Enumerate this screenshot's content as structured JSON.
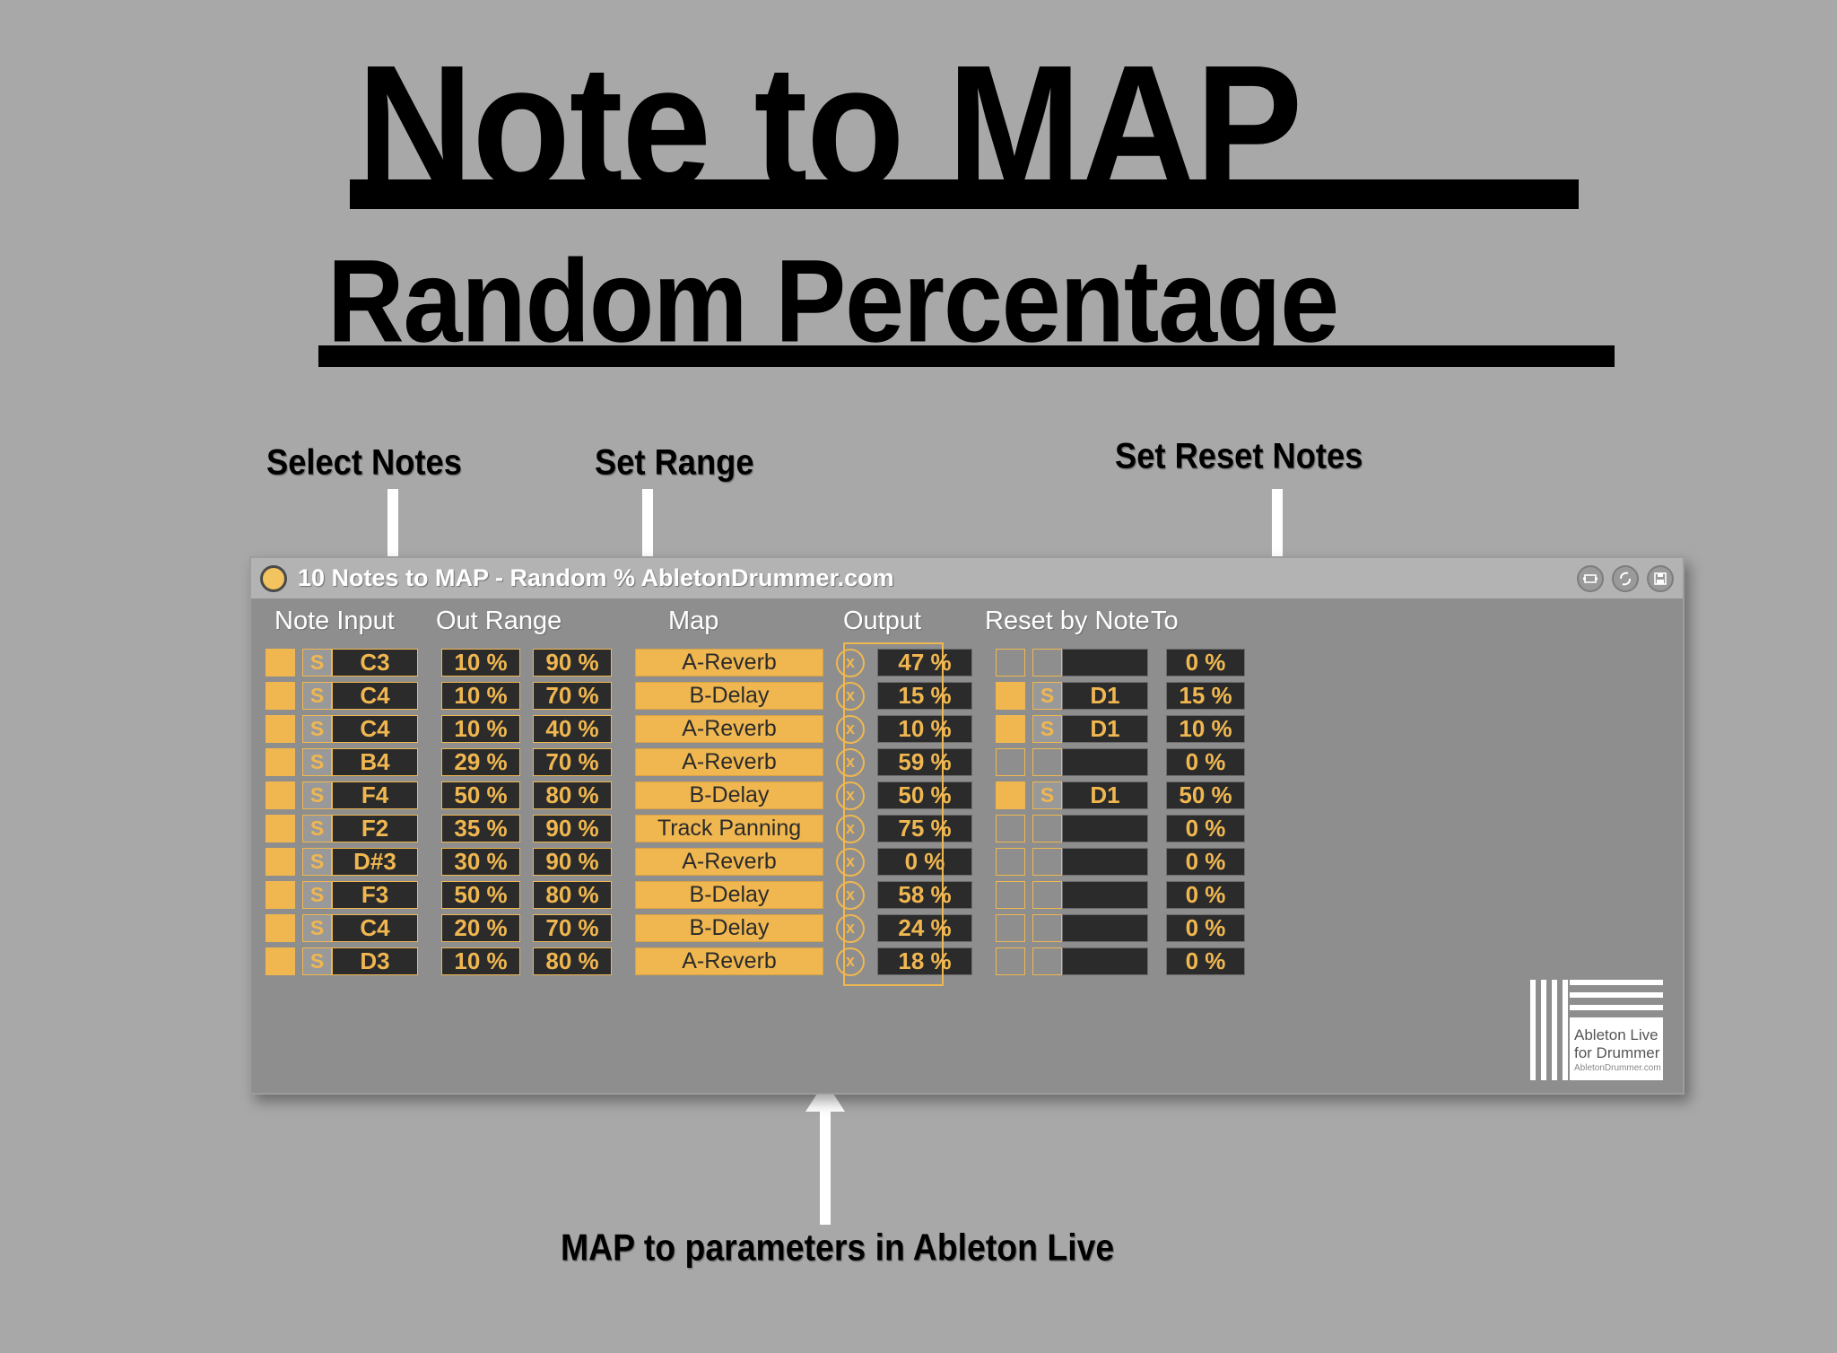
{
  "poster": {
    "title": "Note to MAP",
    "subtitle": "Random Percentage",
    "callouts": {
      "select_notes": "Select Notes",
      "set_range": "Set Range",
      "set_reset_notes": "Set Reset Notes",
      "map_params": "MAP to parameters in Ableton Live"
    }
  },
  "device": {
    "titlebar": {
      "title": "10 Notes to MAP - Random % AbletonDrummer.com",
      "buttons": [
        "patcher-icon",
        "sync-icon",
        "save-icon"
      ]
    },
    "columns": {
      "note_input": "Note Input",
      "out_range": "Out Range",
      "map": "Map",
      "output": "Output",
      "reset_by_note": "Reset by Note",
      "to": "To"
    },
    "solo_label": "S",
    "clear_label": "x",
    "rows": [
      {
        "enabled": true,
        "note": "C3",
        "range_min": "10 %",
        "range_max": "90 %",
        "map": "A-Reverb",
        "output": "47 %",
        "reset_on": false,
        "reset_note": "",
        "to": "0 %"
      },
      {
        "enabled": true,
        "note": "C4",
        "range_min": "10 %",
        "range_max": "70 %",
        "map": "B-Delay",
        "output": "15 %",
        "reset_on": true,
        "reset_note": "D1",
        "to": "15 %"
      },
      {
        "enabled": true,
        "note": "C4",
        "range_min": "10 %",
        "range_max": "40 %",
        "map": "A-Reverb",
        "output": "10 %",
        "reset_on": true,
        "reset_note": "D1",
        "to": "10 %"
      },
      {
        "enabled": true,
        "note": "B4",
        "range_min": "29 %",
        "range_max": "70 %",
        "map": "A-Reverb",
        "output": "59 %",
        "reset_on": false,
        "reset_note": "",
        "to": "0 %"
      },
      {
        "enabled": true,
        "note": "F4",
        "range_min": "50 %",
        "range_max": "80 %",
        "map": "B-Delay",
        "output": "50 %",
        "reset_on": true,
        "reset_note": "D1",
        "to": "50 %"
      },
      {
        "enabled": true,
        "note": "F2",
        "range_min": "35 %",
        "range_max": "90 %",
        "map": "Track Panning",
        "output": "75 %",
        "reset_on": false,
        "reset_note": "",
        "to": "0 %"
      },
      {
        "enabled": true,
        "note": "D#3",
        "range_min": "30 %",
        "range_max": "90 %",
        "map": "A-Reverb",
        "output": "0 %",
        "reset_on": false,
        "reset_note": "",
        "to": "0 %"
      },
      {
        "enabled": true,
        "note": "F3",
        "range_min": "50 %",
        "range_max": "80 %",
        "map": "B-Delay",
        "output": "58 %",
        "reset_on": false,
        "reset_note": "",
        "to": "0 %"
      },
      {
        "enabled": true,
        "note": "C4",
        "range_min": "20 %",
        "range_max": "70 %",
        "map": "B-Delay",
        "output": "24 %",
        "reset_on": false,
        "reset_note": "",
        "to": "0 %"
      },
      {
        "enabled": true,
        "note": "D3",
        "range_min": "10 %",
        "range_max": "80 %",
        "map": "A-Reverb",
        "output": "18 %",
        "reset_on": false,
        "reset_note": "",
        "to": "0 %"
      }
    ],
    "logo": {
      "line1": "Ableton Live",
      "line2": "for Drummer",
      "line3": "AbletonDrummer.com"
    }
  },
  "colors": {
    "background": "#a8a8a8",
    "panel": "#8e8e8e",
    "titlebar": "#b3b3b3",
    "accent_orange": "#f0b750",
    "field_dark": "#2b2b2b",
    "text_white": "#ffffff"
  }
}
